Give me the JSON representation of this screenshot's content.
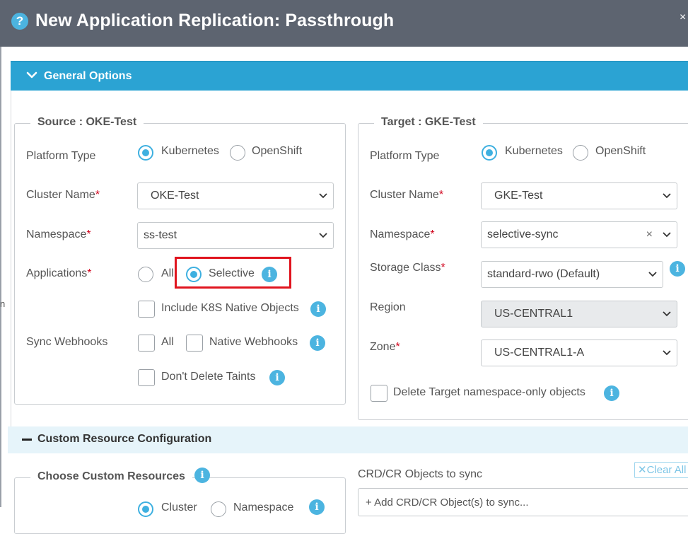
{
  "dialog": {
    "title": "New Application Replication: Passthrough",
    "help_glyph": "?",
    "close_glyph": "×"
  },
  "general": {
    "header": "General Options",
    "source": {
      "legend": "Source : OKE-Test",
      "platform_label": "Platform Type",
      "platform_options": [
        "Kubernetes",
        "OpenShift"
      ],
      "platform_selected": "Kubernetes",
      "cluster_label": "Cluster Name",
      "cluster_value": "OKE-Test",
      "namespace_label": "Namespace",
      "namespace_value": "ss-test",
      "applications_label": "Applications",
      "applications_options": [
        "All",
        "Selective"
      ],
      "applications_selected": "Selective",
      "include_native": "Include K8S Native Objects",
      "sync_webhooks_label": "Sync Webhooks",
      "webhook_all": "All",
      "webhook_native": "Native Webhooks",
      "dont_delete_taints": "Don't Delete Taints"
    },
    "target": {
      "legend": "Target : GKE-Test",
      "platform_label": "Platform Type",
      "platform_options": [
        "Kubernetes",
        "OpenShift"
      ],
      "platform_selected": "Kubernetes",
      "cluster_label": "Cluster Name",
      "cluster_value": "GKE-Test",
      "namespace_label": "Namespace",
      "namespace_value": "selective-sync",
      "storage_label": "Storage Class",
      "storage_value": "standard-rwo (Default)",
      "region_label": "Region",
      "region_value": "US-CENTRAL1",
      "zone_label": "Zone",
      "zone_value": "US-CENTRAL1-A",
      "delete_target_only": "Delete Target namespace-only objects"
    },
    "required_mark": "*"
  },
  "custom": {
    "header": "Custom Resource Configuration",
    "choose_label": "Choose Custom Resources",
    "scope_options": [
      "Cluster",
      "Namespace"
    ],
    "crd_label": "CRD/CR Objects to sync",
    "clear_all": "Clear All",
    "add_placeholder": "+ Add CRD/CR Object(s) to sync..."
  },
  "colors": {
    "titlebar": "#5d6470",
    "accent": "#2ba3d3",
    "info": "#4cb4e0",
    "highlight": "#e0141e"
  },
  "icons": {
    "info_glyph": "i",
    "clear_glyph": "✕",
    "margin_glyph": "n"
  }
}
